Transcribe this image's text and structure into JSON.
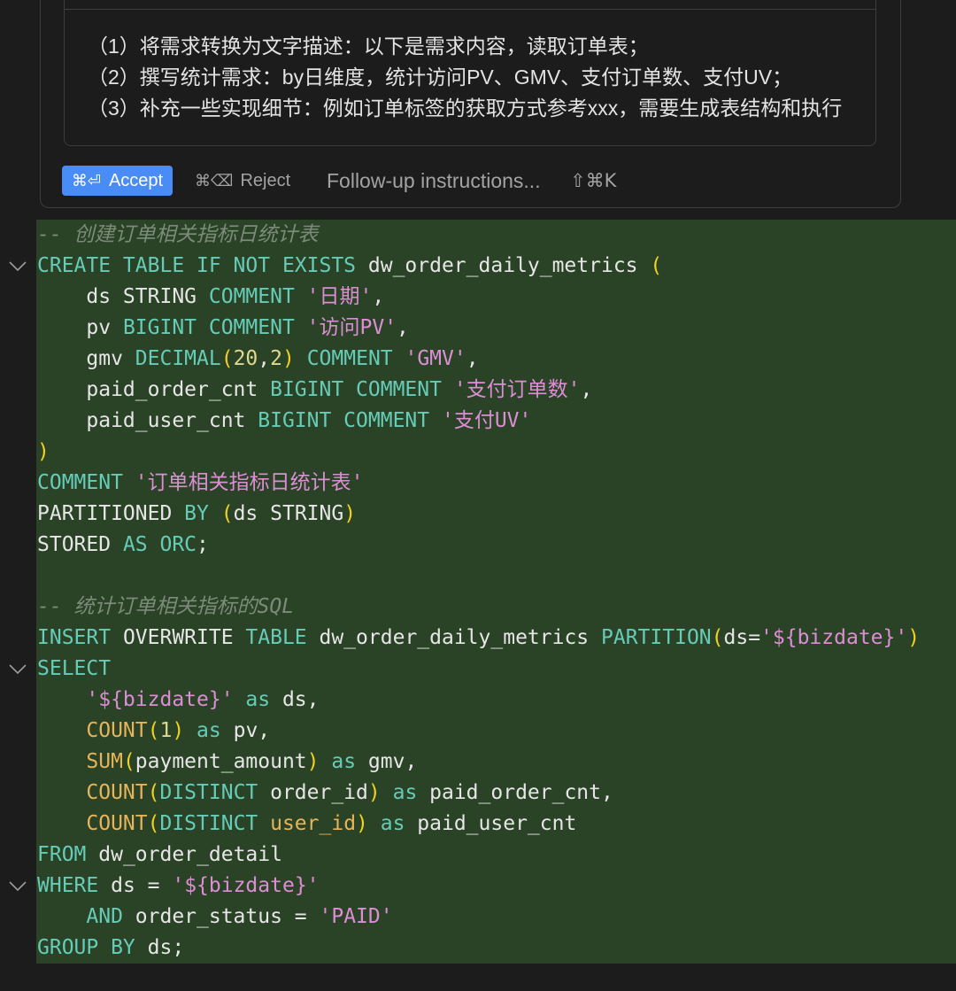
{
  "colors": {
    "page_bg": "#1c1c1c",
    "panel_border": "#3d3d3d",
    "accept_bg": "#4a8cf5",
    "added_line_bg": "#2a4225",
    "prompt_text": "#e3e3e3",
    "muted_text": "#a3a3a3",
    "fold_icon": "#9c9c9c"
  },
  "prompt": {
    "lines": [
      "（1）将需求转换为文字描述：以下是需求内容，读取订单表；",
      "（2）撰写统计需求：by日维度，统计访问PV、GMV、支付订单数、支付UV；",
      "（3）补充一些实现细节：例如订单标签的获取方式参考xxx，需要生成表结构和执行"
    ],
    "accept": {
      "shortcut": "⌘⏎",
      "label": "Accept"
    },
    "reject": {
      "shortcut": "⌘⌫",
      "label": "Reject"
    },
    "follow_up": {
      "placeholder": "Follow-up instructions...",
      "shortcut": "⇧⌘K"
    }
  },
  "editor": {
    "fold_icon": "chevron-down-icon",
    "lines": [
      {
        "tokens": [
          {
            "t": "-- 创建订单相关指标日统计表",
            "c": "#7c8b7a",
            "i": true
          }
        ]
      },
      {
        "fold": true,
        "tokens": [
          {
            "t": "CREATE TABLE IF NOT EXISTS",
            "c": "#66ccb8"
          },
          {
            "t": " dw_order_daily_metrics ",
            "c": "#e6e6e6"
          },
          {
            "t": "(",
            "c": "#f0d21e"
          }
        ]
      },
      {
        "tokens": [
          {
            "t": "    ds STRING ",
            "c": "#e6e6e6"
          },
          {
            "t": "COMMENT ",
            "c": "#66ccb8"
          },
          {
            "t": "'日期'",
            "c": "#dc8ed4"
          },
          {
            "t": ",",
            "c": "#e6e6e6"
          }
        ]
      },
      {
        "tokens": [
          {
            "t": "    pv ",
            "c": "#e6e6e6"
          },
          {
            "t": "BIGINT COMMENT ",
            "c": "#66ccb8"
          },
          {
            "t": "'访问PV'",
            "c": "#dc8ed4"
          },
          {
            "t": ",",
            "c": "#e6e6e6"
          }
        ]
      },
      {
        "tokens": [
          {
            "t": "    gmv ",
            "c": "#e6e6e6"
          },
          {
            "t": "DECIMAL",
            "c": "#66ccb8"
          },
          {
            "t": "(",
            "c": "#f0d21e"
          },
          {
            "t": "20",
            "c": "#dfd98f"
          },
          {
            "t": ",",
            "c": "#e6e6e6"
          },
          {
            "t": "2",
            "c": "#dfd98f"
          },
          {
            "t": ")",
            "c": "#f0d21e"
          },
          {
            "t": " COMMENT ",
            "c": "#66ccb8"
          },
          {
            "t": "'GMV'",
            "c": "#dc8ed4"
          },
          {
            "t": ",",
            "c": "#e6e6e6"
          }
        ]
      },
      {
        "tokens": [
          {
            "t": "    paid_order_cnt ",
            "c": "#e6e6e6"
          },
          {
            "t": "BIGINT COMMENT ",
            "c": "#66ccb8"
          },
          {
            "t": "'支付订单数'",
            "c": "#dc8ed4"
          },
          {
            "t": ",",
            "c": "#e6e6e6"
          }
        ]
      },
      {
        "tokens": [
          {
            "t": "    paid_user_cnt ",
            "c": "#e6e6e6"
          },
          {
            "t": "BIGINT COMMENT ",
            "c": "#66ccb8"
          },
          {
            "t": "'支付UV'",
            "c": "#dc8ed4"
          }
        ]
      },
      {
        "tokens": [
          {
            "t": ")",
            "c": "#f0d21e"
          }
        ]
      },
      {
        "tokens": [
          {
            "t": "COMMENT ",
            "c": "#66ccb8"
          },
          {
            "t": "'订单相关指标日统计表'",
            "c": "#dc8ed4"
          }
        ]
      },
      {
        "tokens": [
          {
            "t": "PARTITIONED ",
            "c": "#e6e6e6"
          },
          {
            "t": "BY ",
            "c": "#66ccb8"
          },
          {
            "t": "(",
            "c": "#f0d21e"
          },
          {
            "t": "ds STRING",
            "c": "#e6e6e6"
          },
          {
            "t": ")",
            "c": "#f0d21e"
          }
        ]
      },
      {
        "tokens": [
          {
            "t": "STORED ",
            "c": "#e6e6e6"
          },
          {
            "t": "AS ORC",
            "c": "#66ccb8"
          },
          {
            "t": ";",
            "c": "#e6e6e6"
          }
        ]
      },
      {
        "tokens": []
      },
      {
        "tokens": [
          {
            "t": "-- 统计订单相关指标的SQL",
            "c": "#7c8b7a",
            "i": true
          }
        ]
      },
      {
        "tokens": [
          {
            "t": "INSERT ",
            "c": "#66ccb8"
          },
          {
            "t": "OVERWRITE ",
            "c": "#e6e6e6"
          },
          {
            "t": "TABLE ",
            "c": "#66ccb8"
          },
          {
            "t": "dw_order_daily_metrics ",
            "c": "#e6e6e6"
          },
          {
            "t": "PARTITION",
            "c": "#66ccb8"
          },
          {
            "t": "(",
            "c": "#f0d21e"
          },
          {
            "t": "ds=",
            "c": "#e6e6e6"
          },
          {
            "t": "'${bizdate}'",
            "c": "#dc8ed4"
          },
          {
            "t": ")",
            "c": "#f0d21e"
          }
        ]
      },
      {
        "fold": true,
        "tokens": [
          {
            "t": "SELECT",
            "c": "#66ccb8"
          }
        ]
      },
      {
        "tokens": [
          {
            "t": "    '${bizdate}'",
            "c": "#dc8ed4"
          },
          {
            "t": " as ",
            "c": "#66ccb8"
          },
          {
            "t": "ds,",
            "c": "#e6e6e6"
          }
        ]
      },
      {
        "tokens": [
          {
            "t": "    COUNT",
            "c": "#e6b45a"
          },
          {
            "t": "(",
            "c": "#f0d21e"
          },
          {
            "t": "1",
            "c": "#dfd98f"
          },
          {
            "t": ")",
            "c": "#f0d21e"
          },
          {
            "t": " as ",
            "c": "#66ccb8"
          },
          {
            "t": "pv,",
            "c": "#e6e6e6"
          }
        ]
      },
      {
        "tokens": [
          {
            "t": "    SUM",
            "c": "#e6b45a"
          },
          {
            "t": "(",
            "c": "#f0d21e"
          },
          {
            "t": "payment_amount",
            "c": "#e6e6e6"
          },
          {
            "t": ")",
            "c": "#f0d21e"
          },
          {
            "t": " as ",
            "c": "#66ccb8"
          },
          {
            "t": "gmv,",
            "c": "#e6e6e6"
          }
        ]
      },
      {
        "tokens": [
          {
            "t": "    COUNT",
            "c": "#e6b45a"
          },
          {
            "t": "(",
            "c": "#f0d21e"
          },
          {
            "t": "DISTINCT ",
            "c": "#66ccb8"
          },
          {
            "t": "order_id",
            "c": "#e6e6e6"
          },
          {
            "t": ")",
            "c": "#f0d21e"
          },
          {
            "t": " as ",
            "c": "#66ccb8"
          },
          {
            "t": "paid_order_cnt,",
            "c": "#e6e6e6"
          }
        ]
      },
      {
        "tokens": [
          {
            "t": "    COUNT",
            "c": "#e6b45a"
          },
          {
            "t": "(",
            "c": "#f0d21e"
          },
          {
            "t": "DISTINCT ",
            "c": "#66ccb8"
          },
          {
            "t": "user_id",
            "c": "#e6b45a"
          },
          {
            "t": ")",
            "c": "#f0d21e"
          },
          {
            "t": " as ",
            "c": "#66ccb8"
          },
          {
            "t": "paid_user_cnt",
            "c": "#e6e6e6"
          }
        ]
      },
      {
        "tokens": [
          {
            "t": "FROM ",
            "c": "#66ccb8"
          },
          {
            "t": "dw_order_detail",
            "c": "#e6e6e6"
          }
        ]
      },
      {
        "fold": true,
        "tokens": [
          {
            "t": "WHERE ",
            "c": "#66ccb8"
          },
          {
            "t": "ds = ",
            "c": "#e6e6e6"
          },
          {
            "t": "'${bizdate}'",
            "c": "#dc8ed4"
          }
        ]
      },
      {
        "tokens": [
          {
            "t": "    AND ",
            "c": "#66ccb8"
          },
          {
            "t": "order_status = ",
            "c": "#e6e6e6"
          },
          {
            "t": "'PAID'",
            "c": "#dc8ed4"
          }
        ]
      },
      {
        "tokens": [
          {
            "t": "GROUP BY ",
            "c": "#66ccb8"
          },
          {
            "t": "ds;",
            "c": "#e6e6e6"
          }
        ]
      }
    ]
  }
}
